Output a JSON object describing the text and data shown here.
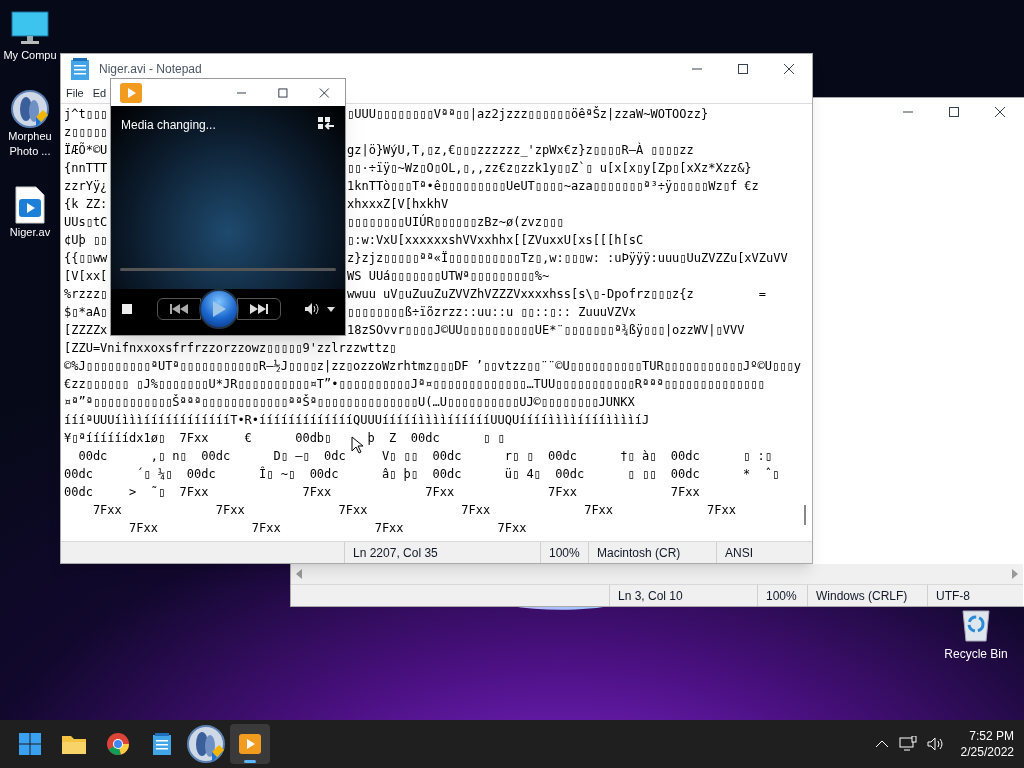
{
  "desktop_icons": [
    {
      "kind": "computer",
      "lines": [
        "My Compu"
      ]
    },
    {
      "kind": "morpheus",
      "lines": [
        "Morpheu",
        "Photo ..."
      ]
    },
    {
      "kind": "video",
      "lines": [
        "Niger.av"
      ]
    }
  ],
  "recycle_bin": {
    "label": "Recycle Bin"
  },
  "back_notepad": {
    "status": [
      "Ln 3, Col 10",
      "100%",
      "Windows (CRLF)",
      "UTF-8"
    ]
  },
  "notepad": {
    "title": "Niger.avi - Notepad",
    "menu": [
      "File",
      "Ed"
    ],
    "split_rows": [
      {
        "left": "j^t▯▯▯",
        "right": "▯UUU▯▯▯▯▯▯▯▯Vªª▯▯|az2jzzz▯▯▯▯▯▯öêªŠz|zzaW~WOTOOzz}"
      },
      {
        "left": "z▯▯▯▯▯",
        "right": ""
      },
      {
        "left": "ÏÆÕ*©U",
        "right": "gz|ö}WýU,T,▯z,€▯▯▯zzzzzz_'zpWx€z}z▯▯▯▯R—À ▯▯▯▯zz"
      },
      {
        "left": "{nnTTT",
        "right": "▯▯·÷ïÿ▯~Wz▯O▯OL,▯,,zz€z▯zzk1y▯▯Z`▯ u[x[x▯y[Zp▯[xXz*Xzz&}"
      },
      {
        "left": "zzrYÿ¿",
        "right": "1knTTò▯▯▯Tª•ê▯▯▯▯▯▯▯▯▯UeUT▯▯▯▯~aza▯▯▯▯▯▯▯ª³÷ÿ▯▯▯▯▯Wz▯f €z"
      },
      {
        "left": "{k ZZ:",
        "right": "xhxxxZ[V[hxkhV"
      },
      {
        "left": "UUs▯tC",
        "right": "▯▯▯▯▯▯▯▯UIÚR▯▯▯▯▯▯zBz~ø(zvz▯▯▯"
      },
      {
        "left": "¢Uþ ▯▯",
        "right": "▯:w:VxU[xxxxxxshVVxxhhx[[ZVuxxU[xs[[[h[sC"
      },
      {
        "left": "{{▯▯ww",
        "right": "z}zjz▯▯▯▯▯ªª«Ï▯▯▯▯▯▯▯▯▯▯Tz▯,w:▯▯▯w: :uÞÿÿÿ:uuu▯UuZVZZu[xVZuVV"
      },
      {
        "left": "[V[xx[",
        "right": "WS UUá▯▯▯▯▯▯▯UTWª▯▯▯▯▯▯▯▯▯%~"
      },
      {
        "left": "%rzzz▯",
        "right": "wwuu uV▯uZuuZuZVVZhVZZZVxxxxhss[s\\▯-Dpofrz▯▯▯z{z         ="
      },
      {
        "left": "$▯*aA▯",
        "right": "▯▯▯▯▯▯▯▯ß÷ïõzrzz::uu::u ▯▯::▯:: ZuuuVZVx"
      },
      {
        "left": "[ZZZZx",
        "right": "18zSOvvr▯▯▯▯J©UU▯▯▯▯▯▯▯▯▯▯UE*¨▯▯▯▯▯▯▯ª¾ßÿ▯▯▯|ozzWV|▯VVV"
      }
    ],
    "lines": [
      "[ZZU=Vnifnxxoxsfrfrzzorzzowz▯▯▯▯▯9'zzlrzzwttz▯",
      "©%J▯▯▯▯▯▯▯▯▯ªUTª▯▯▯▯▯▯▯▯▯▯▯R—½J▯▯▯▯z|zz▯ozzoWzrhtmz▯▯▯DF ’▯▯vtzz▯▯¨¨©U▯▯▯▯▯▯▯▯▯▯TUR▯▯▯▯▯▯▯▯▯▯▯Jº©U▯▯▯y",
      "€zz▯▯▯▯▯▯ ▯J%▯▯▯▯▯▯▯U*JR▯▯▯▯▯▯▯▯▯▯¤T”•▯▯▯▯▯▯▯▯▯▯Jª¤▯▯▯▯▯▯▯▯▯▯▯▯▯…TUU▯▯▯▯▯▯▯▯▯▯▯Rªªª▯▯▯▯▯▯▯▯▯▯▯▯▯▯",
      "¤ª”ª▯▯▯▯▯▯▯▯▯▯▯Šªªª▯▯▯▯▯▯▯▯▯▯▯▯ªªŠª▯▯▯▯▯▯▯▯▯▯▯▯▯▯U(…U▯▯▯▯▯▯▯▯▯▯UJ©▯▯▯▯▯▯▯▯JUNKX",
      "íííªUUUíìììííííííííííííT•R•íííííííííííííQUUUíííííììììííííííUUQUííííììììííííììììíJ",
      "¥▯ªíííííídx1ø▯  7Fxx     €      00db▯     þ  Z  00dc      ▯ ▯",
      "  00dc      ,▯ n▯  00dc      D▯ –▯  0dc     V▯ ▯▯  00dc      r▯ ▯  00dc      †▯ à▯  00dc      ▯ :▯",
      "00dc      ´▯ ¼▯  00dc      Î▯ ~▯  00dc      â▯ þ▯  00dc      ü▯ 4▯  00dc      ▯ ▯▯  00dc      *  ˆ▯",
      "00dc     >  ˜▯  7Fxx             7Fxx             7Fxx             7Fxx             7Fxx",
      "    7Fxx             7Fxx             7Fxx             7Fxx             7Fxx             7Fxx",
      "         7Fxx             7Fxx             7Fxx             7Fxx"
    ],
    "status": [
      "Ln 2207, Col 35",
      "100%",
      "Macintosh (CR)",
      "ANSI"
    ]
  },
  "media_player": {
    "status_text": "Media changing..."
  },
  "taskbar": {
    "apps": [
      {
        "kind": "start",
        "selected": false
      },
      {
        "kind": "folder",
        "selected": false
      },
      {
        "kind": "browser",
        "selected": false
      },
      {
        "kind": "notepad",
        "selected": false
      },
      {
        "kind": "morpheus",
        "selected": false
      },
      {
        "kind": "player",
        "selected": true
      }
    ],
    "time": "7:52 PM",
    "date": "2/25/2022"
  }
}
